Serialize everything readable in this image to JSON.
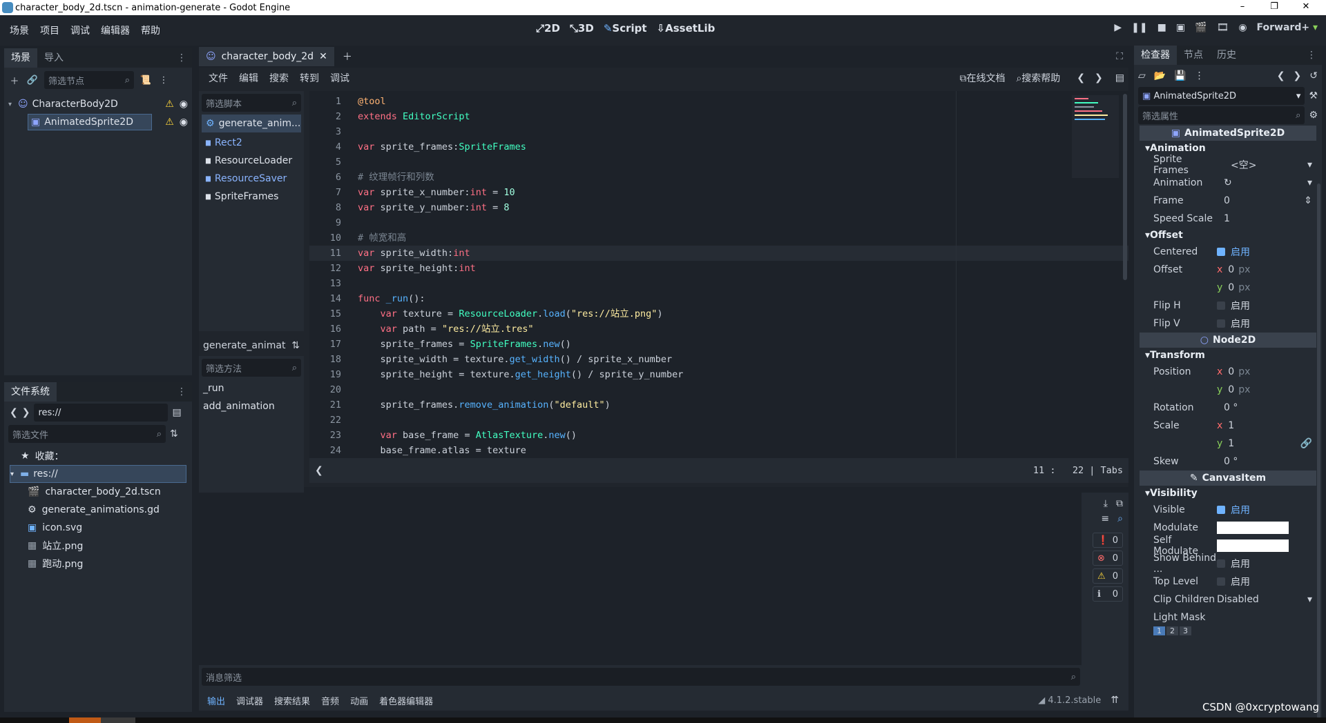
{
  "window": {
    "title": "character_body_2d.tscn - animation-generate - Godot Engine",
    "controls": [
      "–",
      "❐",
      "✕"
    ]
  },
  "menu": [
    "场景",
    "项目",
    "调试",
    "编辑器",
    "帮助"
  ],
  "workspaces": [
    {
      "label": "2D",
      "active": false
    },
    {
      "label": "3D",
      "active": false
    },
    {
      "label": "Script",
      "active": true
    },
    {
      "label": "AssetLib",
      "active": false
    }
  ],
  "renderer": "Forward+",
  "scene_dock": {
    "tabs": [
      "场景",
      "导入"
    ],
    "filter_placeholder": "筛选节点",
    "nodes": [
      {
        "name": "CharacterBody2D",
        "level": 0
      },
      {
        "name": "AnimatedSprite2D",
        "level": 1,
        "selected": true
      }
    ]
  },
  "filesystem_dock": {
    "title": "文件系统",
    "path": "res://",
    "filter_placeholder": "筛选文件",
    "favorites": "收藏：",
    "root": "res://",
    "files": [
      "character_body_2d.tscn",
      "generate_animations.gd",
      "icon.svg",
      "站立.png",
      "跑动.png"
    ]
  },
  "script_editor": {
    "tab_title": "character_body_2d",
    "menu": [
      "文件",
      "编辑",
      "搜索",
      "转到",
      "调试"
    ],
    "online_docs": "在线文档",
    "search_help": "搜索帮助",
    "script_filter_placeholder": "筛选脚本",
    "scripts": [
      "generate_anim...",
      "Rect2",
      "ResourceLoader",
      "ResourceSaver",
      "SpriteFrames"
    ],
    "current_script": "generate_animat",
    "method_filter_placeholder": "筛选方法",
    "methods": [
      "_run",
      "add_animation"
    ],
    "cursor": {
      "line": "11",
      "col": "22",
      "indent": "Tabs"
    }
  },
  "code_lines": [
    {
      "n": "1",
      "html": "<span class=\"an\">@tool</span>"
    },
    {
      "n": "2",
      "html": "<span class=\"kw\">extends</span> <span class=\"ty\">EditorScript</span>"
    },
    {
      "n": "3",
      "html": ""
    },
    {
      "n": "4",
      "html": "<span class=\"kw\">var</span> sprite_frames:<span class=\"ty\">SpriteFrames</span>"
    },
    {
      "n": "5",
      "html": ""
    },
    {
      "n": "6",
      "html": "<span class=\"cm\"># 纹理帧行和列数</span>"
    },
    {
      "n": "7",
      "html": "<span class=\"kw\">var</span> sprite_x_number:<span class=\"kw\">int</span> = <span class=\"nu\">10</span>"
    },
    {
      "n": "8",
      "html": "<span class=\"kw\">var</span> sprite_y_number:<span class=\"kw\">int</span> = <span class=\"nu\">8</span>"
    },
    {
      "n": "9",
      "html": ""
    },
    {
      "n": "10",
      "html": "<span class=\"cm\"># 帧宽和高</span>"
    },
    {
      "n": "11",
      "html": "<span class=\"kw\">var</span> sprite_width:<span class=\"kw\">int</span>"
    },
    {
      "n": "12",
      "html": "<span class=\"kw\">var</span> sprite_height:<span class=\"kw\">int</span>"
    },
    {
      "n": "13",
      "html": ""
    },
    {
      "n": "14",
      "html": "<span class=\"kw\">func</span> <span class=\"fn\">_run</span>():"
    },
    {
      "n": "15",
      "html": "    <span class=\"kw\">var</span> texture = <span class=\"ty\">ResourceLoader</span>.<span class=\"fn\">load</span>(<span class=\"st\">\"res://站立.png\"</span>)"
    },
    {
      "n": "16",
      "html": "    <span class=\"kw\">var</span> path = <span class=\"st\">\"res://站立.tres\"</span>"
    },
    {
      "n": "17",
      "html": "    sprite_frames = <span class=\"ty\">SpriteFrames</span>.<span class=\"fn\">new</span>()"
    },
    {
      "n": "18",
      "html": "    sprite_width = texture.<span class=\"fn\">get_width</span>() / sprite_x_number"
    },
    {
      "n": "19",
      "html": "    sprite_height = texture.<span class=\"fn\">get_height</span>() / sprite_y_number"
    },
    {
      "n": "20",
      "html": ""
    },
    {
      "n": "21",
      "html": "    sprite_frames.<span class=\"fn\">remove_animation</span>(<span class=\"st\">\"default\"</span>)"
    },
    {
      "n": "22",
      "html": ""
    },
    {
      "n": "23",
      "html": "    <span class=\"kw\">var</span> base_frame = <span class=\"ty\">AtlasTexture</span>.<span class=\"fn\">new</span>()"
    },
    {
      "n": "24",
      "html": "    base_frame.atlas = texture"
    }
  ],
  "output_panel": {
    "filter_placeholder": "消息筛选",
    "counts": [
      "0",
      "0",
      "0",
      "0"
    ],
    "bottom_tabs": [
      "输出",
      "调试器",
      "搜索结果",
      "音频",
      "动画",
      "着色器编辑器"
    ],
    "version": "4.1.2.stable"
  },
  "inspector": {
    "tabs": [
      "检查器",
      "节点",
      "历史"
    ],
    "object": "AnimatedSprite2D",
    "filter_placeholder": "筛选属性",
    "class_header": "AnimatedSprite2D",
    "enable": "启用",
    "sections": {
      "animation": "Animation",
      "offset": "Offset",
      "node2d": "Node2D",
      "transform": "Transform",
      "canvasitem": "CanvasItem",
      "visibility": "Visibility"
    },
    "props": {
      "sprite_frames": "Sprite Frames",
      "sprite_frames_val": "<空>",
      "animation": "Animation",
      "frame": "Frame",
      "frame_val": "0",
      "speed_scale": "Speed Scale",
      "speed_scale_val": "1",
      "centered": "Centered",
      "offset": "Offset",
      "offset_x": "0",
      "offset_y": "0",
      "flip_h": "Flip H",
      "flip_v": "Flip V",
      "position": "Position",
      "pos_x": "0",
      "pos_y": "0",
      "rotation": "Rotation",
      "rotation_val": "0 °",
      "scale": "Scale",
      "scale_x": "1",
      "scale_y": "1",
      "skew": "Skew",
      "skew_val": "0 °",
      "visible": "Visible",
      "modulate": "Modulate",
      "self_modulate": "Self Modulate",
      "show_behind": "Show Behind ...",
      "top_level": "Top Level",
      "clip_children": "Clip Children",
      "clip_children_val": "Disabled",
      "light_mask": "Light Mask",
      "light_mask_layers": [
        "1",
        "2",
        "3"
      ]
    },
    "units": {
      "px": "px",
      "x": "x",
      "y": "y"
    }
  },
  "watermark": "CSDN @0xcryptowang",
  "colors": {
    "accent": "#6fb3ff",
    "renderer": "#8ad05a",
    "bg": "#1d2229"
  }
}
